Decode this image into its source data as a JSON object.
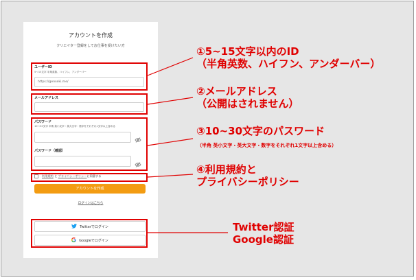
{
  "card": {
    "title": "アカウントを作成",
    "subtitle": "クリエイター登録をしてお仕事を受けたい方",
    "user_id": {
      "label": "ユーザーID",
      "hint": "5～15文字 半角英数、ハイフン、アンダーバー",
      "prefix": "https://genseki.me/"
    },
    "email": {
      "label": "メールアドレス"
    },
    "password": {
      "label": "パスワード",
      "hint": "10～30文字 半角 英小文字・英大文字・数字をそれぞれ1文字以上含める"
    },
    "password_confirm": {
      "label": "パスワード（確認）"
    },
    "terms": {
      "link1": "利用規約",
      "and": "と",
      "link2": "プライバシーポリシー",
      "suffix": "に同意する"
    },
    "submit_label": "アカウントを作成",
    "login_link": "ログインはこちら",
    "twitter_label": "Twitterでログイン",
    "google_label": "Googleでログイン"
  },
  "annotations": {
    "a1_title": "①5~15文字以内のID",
    "a1_sub": "（半角英数、ハイフン、アンダーバー）",
    "a2_title": "②メールアドレス",
    "a2_sub": "（公開はされません）",
    "a3_title": "③10~30文字のパスワード",
    "a3_sub": "（半角 英小文字・英大文字・数字をそれぞれ1文字以上含める）",
    "a4_line1": "④利用規約と",
    "a4_line2": "プライバシーポリシー",
    "a5_line1": "Twitter認証",
    "a5_line2": "Google認証"
  },
  "colors": {
    "accent": "#f39c12",
    "annotation_red": "#e00000",
    "twitter_blue": "#1da1f2"
  },
  "icons": [
    "eye-slash-icon",
    "twitter-bird-icon",
    "google-g-icon"
  ]
}
